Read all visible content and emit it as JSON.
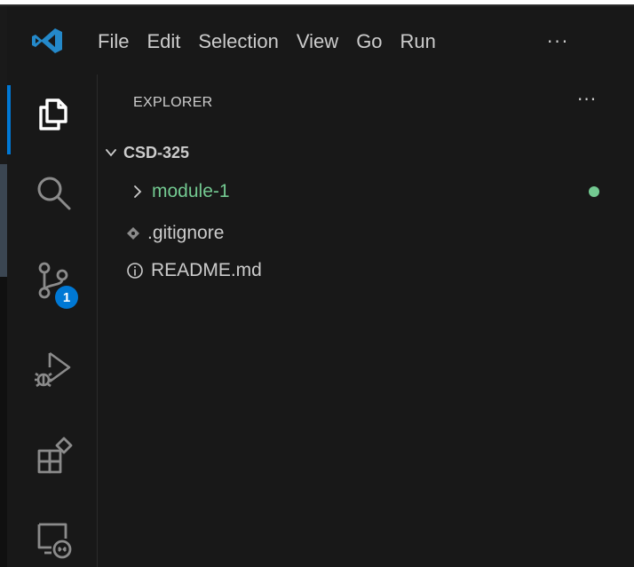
{
  "menu": {
    "items": [
      "File",
      "Edit",
      "Selection",
      "View",
      "Go",
      "Run"
    ],
    "overflow": "···"
  },
  "activity_bar": {
    "icons": [
      "explorer-icon",
      "search-icon",
      "source-control-icon",
      "run-debug-icon",
      "extensions-icon",
      "remote-explorer-icon"
    ],
    "source_control_badge": "1"
  },
  "explorer": {
    "title": "EXPLORER",
    "more": "···",
    "root_folder": "CSD-325",
    "items": [
      {
        "name": "module-1",
        "type": "folder",
        "status_color": "#73c991"
      },
      {
        "name": ".gitignore",
        "type": "file",
        "icon": "git-icon"
      },
      {
        "name": "README.md",
        "type": "file",
        "icon": "info-icon"
      }
    ]
  },
  "colors": {
    "background": "#181818",
    "accent": "#0078d4",
    "modified_green": "#73c991",
    "text": "#cccccc"
  }
}
